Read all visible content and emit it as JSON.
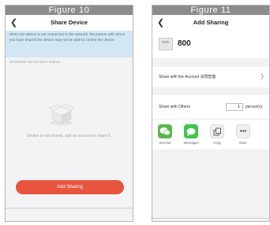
{
  "figure_left": {
    "figure_label": "Figure 10",
    "back_icon": "chevron-left-icon",
    "title": "Share Device",
    "notice": "When the device is not connected to the network, the person with whom you have shared the device may not be able to control the device.",
    "device_note": "SC000MS has not been shared",
    "empty_text": "Device is not shared, add an account to share it.",
    "add_button": "Add Sharing",
    "colors": {
      "notice_bg": "#d2e6f3",
      "button": "#e8553f",
      "body_bg": "#f3f3f5"
    }
  },
  "figure_right": {
    "figure_label": "Figure 11",
    "back_icon": "chevron-left-icon",
    "title": "Add Sharing",
    "device_name": "800",
    "account_row": "Share with the Account 涂鸦智能",
    "others_label": "Share with Others",
    "person_count": "1",
    "person_unit": "person(s)",
    "share_options": [
      {
        "label": "WeChat",
        "icon": "wechat-icon",
        "color": "#58b94a"
      },
      {
        "label": "Messages",
        "icon": "messages-icon",
        "color": "#3cc64c"
      },
      {
        "label": "Copy",
        "icon": "copy-icon",
        "color": "#efefef"
      },
      {
        "label": "More",
        "icon": "more-icon",
        "color": "#efefef"
      }
    ]
  }
}
